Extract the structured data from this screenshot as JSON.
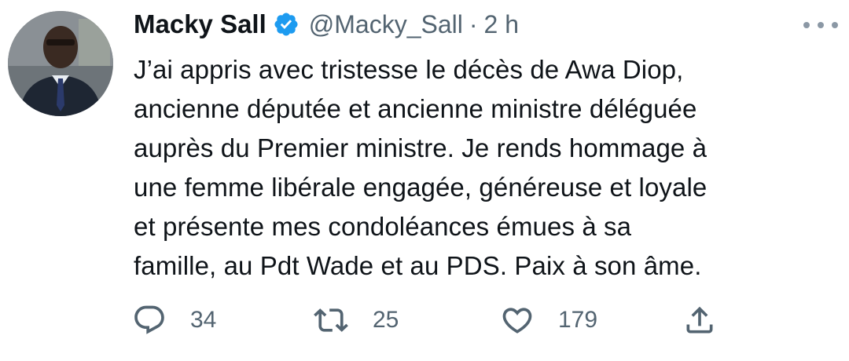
{
  "tweet": {
    "author_name": "Macky Sall",
    "handle": "@Macky_Sall",
    "separator": "·",
    "time": "2 h",
    "text": "J’ai appris avec tristesse le décès de Awa Diop,\nancienne députée et ancienne ministre déléguée\nauprès du Premier ministre. Je rends hommage à\nune femme libérale engagée, généreuse et loyale\net présente mes condoléances émues à sa\nfamille, au Pdt Wade et au PDS. Paix à son âme."
  },
  "actions": {
    "reply_count": "34",
    "retweet_count": "25",
    "like_count": "179"
  },
  "colors": {
    "verified_badge": "#1d9bf0",
    "secondary_text": "#536471",
    "icon": "#536471"
  }
}
